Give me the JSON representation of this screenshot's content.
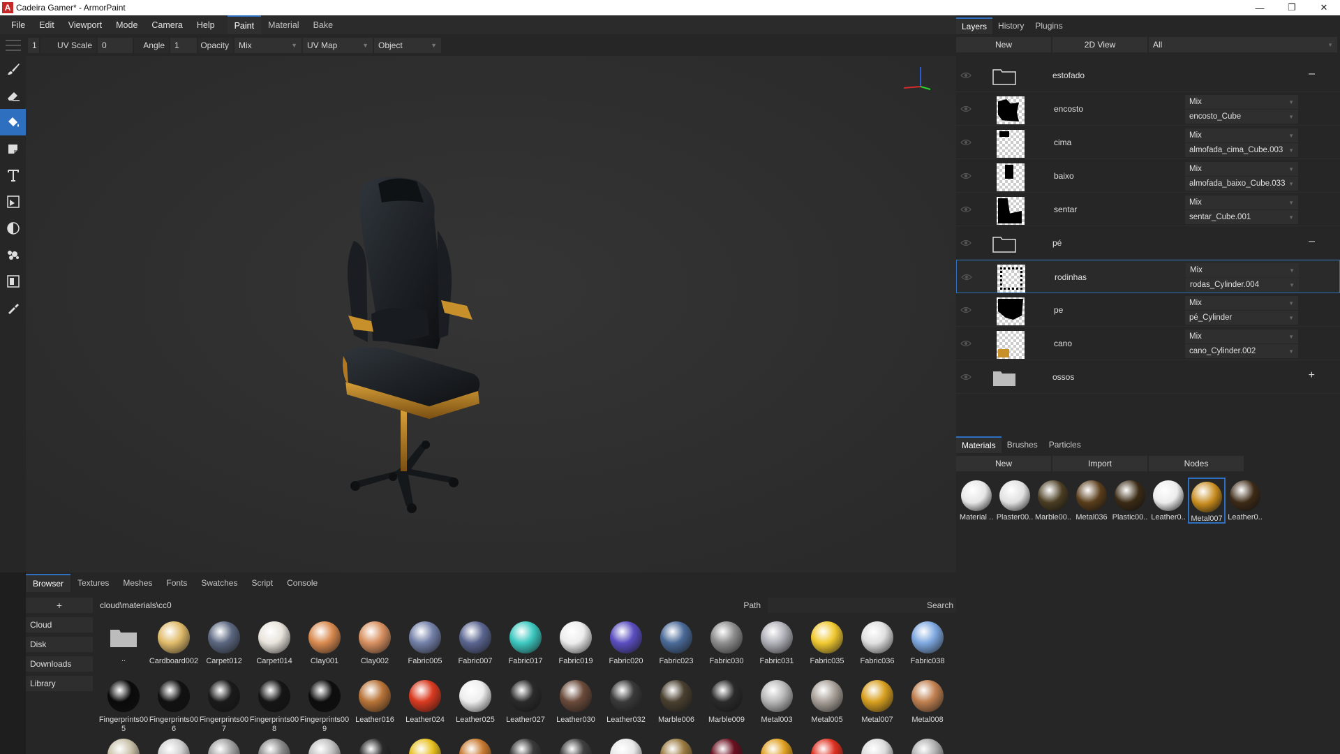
{
  "window": {
    "title": "Cadeira Gamer* - ArmorPaint"
  },
  "menu": [
    "File",
    "Edit",
    "Viewport",
    "Mode",
    "Camera",
    "Help"
  ],
  "workspace_tabs": [
    {
      "label": "Paint",
      "active": true
    },
    {
      "label": "Material",
      "active": false
    },
    {
      "label": "Bake",
      "active": false
    }
  ],
  "tool_options": {
    "uv_scale_value": "1",
    "uv_scale_label": "UV Scale",
    "angle_value": "0",
    "angle_label": "Angle",
    "opacity_value": "1",
    "opacity_label": "Opacity",
    "blending": "Mix",
    "texcoord": "UV Map",
    "mask": "Object"
  },
  "tools": [
    {
      "name": "brush-icon",
      "active": false
    },
    {
      "name": "eraser-icon",
      "active": false
    },
    {
      "name": "fill-icon",
      "active": true
    },
    {
      "name": "decal-icon",
      "active": false
    },
    {
      "name": "text-icon",
      "active": false
    },
    {
      "name": "clone-icon",
      "active": false
    },
    {
      "name": "blur-icon",
      "active": false
    },
    {
      "name": "particle-icon",
      "active": false
    },
    {
      "name": "bake-icon",
      "active": false
    },
    {
      "name": "picker-icon",
      "active": false
    }
  ],
  "right_panel": {
    "tabs": [
      {
        "label": "Layers",
        "active": true
      },
      {
        "label": "History",
        "active": false
      },
      {
        "label": "Plugins",
        "active": false
      }
    ],
    "buttons": {
      "new": "New",
      "view2d": "2D View",
      "filter": "All"
    },
    "layers": [
      {
        "type": "group",
        "name": "estofado",
        "sign": "–"
      },
      {
        "type": "layer",
        "name": "encosto",
        "blend": "Mix",
        "object": "encosto_Cube"
      },
      {
        "type": "layer",
        "name": "cima",
        "blend": "Mix",
        "object": "almofada_cima_Cube.003"
      },
      {
        "type": "layer",
        "name": "baixo",
        "blend": "Mix",
        "object": "almofada_baixo_Cube.033"
      },
      {
        "type": "layer",
        "name": "sentar",
        "blend": "Mix",
        "object": "sentar_Cube.001"
      },
      {
        "type": "group",
        "name": "pé",
        "sign": "–"
      },
      {
        "type": "layer",
        "name": "rodinhas",
        "blend": "Mix",
        "object": "rodas_Cylinder.004",
        "selected": true
      },
      {
        "type": "layer",
        "name": "pe",
        "blend": "Mix",
        "object": "pé_Cylinder"
      },
      {
        "type": "layer",
        "name": "cano",
        "blend": "Mix",
        "object": "cano_Cylinder.002"
      },
      {
        "type": "group",
        "name": "ossos",
        "sign": "+"
      }
    ],
    "material_tabs": [
      {
        "label": "Materials",
        "active": true
      },
      {
        "label": "Brushes",
        "active": false
      },
      {
        "label": "Particles",
        "active": false
      }
    ],
    "material_buttons": {
      "new": "New",
      "import": "Import",
      "nodes": "Nodes"
    },
    "materials": [
      {
        "name": "Material ..",
        "color": "#e6e6e6"
      },
      {
        "name": "Plaster00..",
        "color": "#e0e0e0"
      },
      {
        "name": "Marble00..",
        "color": "#4a3d22"
      },
      {
        "name": "Metal036",
        "color": "#5a3d1a"
      },
      {
        "name": "Plastic00..",
        "color": "#3a2a14"
      },
      {
        "name": "Leather0..",
        "color": "#ececec"
      },
      {
        "name": "Metal007",
        "color": "#c68a1c",
        "selected": true
      },
      {
        "name": "Leather0..",
        "color": "#3d2a16"
      }
    ]
  },
  "bottom": {
    "tabs": [
      {
        "label": "Browser",
        "active": true
      },
      {
        "label": "Textures",
        "active": false
      },
      {
        "label": "Meshes",
        "active": false
      },
      {
        "label": "Fonts",
        "active": false
      },
      {
        "label": "Swatches",
        "active": false
      },
      {
        "label": "Script",
        "active": false
      },
      {
        "label": "Console",
        "active": false
      }
    ],
    "add_label": "+",
    "path": "cloud\\materials\\cc0",
    "path_label": "Path",
    "search_label": "Search",
    "places": [
      "Cloud",
      "Disk",
      "Downloads",
      "Library"
    ],
    "items_row1": [
      {
        "name": "..",
        "folder": true
      },
      {
        "name": "Cardboard002",
        "color": "#e0bb6a"
      },
      {
        "name": "Carpet012",
        "color": "#5b6780"
      },
      {
        "name": "Carpet014",
        "color": "#e8e4dc"
      },
      {
        "name": "Clay001",
        "color": "#d98a4f"
      },
      {
        "name": "Clay002",
        "color": "#d89060"
      },
      {
        "name": "Fabric005",
        "color": "#7380a8"
      },
      {
        "name": "Fabric007",
        "color": "#5a6590"
      },
      {
        "name": "Fabric017",
        "color": "#3cc8c0"
      },
      {
        "name": "Fabric019",
        "color": "#ededed"
      },
      {
        "name": "Fabric020",
        "color": "#5a4ec0"
      },
      {
        "name": "Fabric023",
        "color": "#4a6a98"
      },
      {
        "name": "Fabric030",
        "color": "#8d8d8d"
      },
      {
        "name": "Fabric031",
        "color": "#b0b0b8"
      },
      {
        "name": "Fabric035",
        "color": "#f0c830"
      },
      {
        "name": "Fabric036",
        "color": "#e0e0e0"
      },
      {
        "name": "Fabric038",
        "color": "#7ea8e0"
      }
    ],
    "items_row2": [
      {
        "name": "Fingerprints005",
        "color": "#0a0a0a"
      },
      {
        "name": "Fingerprints006",
        "color": "#111111"
      },
      {
        "name": "Fingerprints007",
        "color": "#1a1a1a"
      },
      {
        "name": "Fingerprints008",
        "color": "#151515"
      },
      {
        "name": "Fingerprints009",
        "color": "#0d0d0d"
      },
      {
        "name": "Leather016",
        "color": "#b87438"
      },
      {
        "name": "Leather024",
        "color": "#d93a20"
      },
      {
        "name": "Leather025",
        "color": "#eeeeee"
      },
      {
        "name": "Leather027",
        "color": "#2a2a2a"
      },
      {
        "name": "Leather030",
        "color": "#6a4a3a"
      },
      {
        "name": "Leather032",
        "color": "#3a3a3a"
      },
      {
        "name": "Marble006",
        "color": "#4a4030"
      },
      {
        "name": "Marble009",
        "color": "#2a2a2a"
      },
      {
        "name": "Metal003",
        "color": "#b8b8b8"
      },
      {
        "name": "Metal005",
        "color": "#a8a098"
      },
      {
        "name": "Metal007",
        "color": "#d8a020"
      },
      {
        "name": "Metal008",
        "color": "#c08050"
      }
    ],
    "items_row3_colors": [
      "#c8c0a8",
      "#d0d0d0",
      "#a0a0a0",
      "#8a8a8a",
      "#c0c0c0",
      "#2a2a2a",
      "#e8c020",
      "#c87a30",
      "#3a3a3a",
      "#404040",
      "#e8e8e8",
      "#9a7a40",
      "#6a1020",
      "#e0a020",
      "#e03020",
      "#dcdcdc",
      "#b0b0b0"
    ]
  }
}
